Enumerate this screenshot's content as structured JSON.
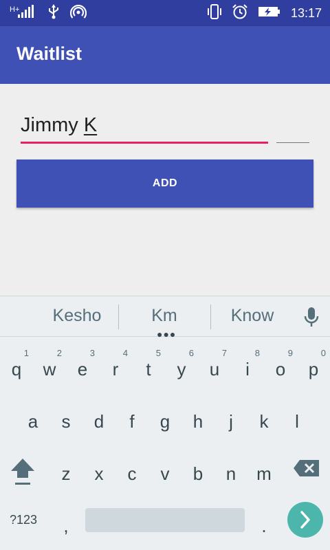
{
  "status_bar": {
    "network_label": "H+",
    "time": "13:17"
  },
  "app_bar": {
    "title": "Waitlist"
  },
  "form": {
    "name_value_first": "Jimmy ",
    "name_value_last": "K",
    "party_count_value": "",
    "add_button_label": "ADD"
  },
  "keyboard": {
    "suggestions": [
      "Kesho",
      "Km",
      "Know"
    ],
    "row1": [
      {
        "ch": "q",
        "num": "1"
      },
      {
        "ch": "w",
        "num": "2"
      },
      {
        "ch": "e",
        "num": "3"
      },
      {
        "ch": "r",
        "num": "4"
      },
      {
        "ch": "t",
        "num": "5"
      },
      {
        "ch": "y",
        "num": "6"
      },
      {
        "ch": "u",
        "num": "7"
      },
      {
        "ch": "i",
        "num": "8"
      },
      {
        "ch": "o",
        "num": "9"
      },
      {
        "ch": "p",
        "num": "0"
      }
    ],
    "row2": [
      "a",
      "s",
      "d",
      "f",
      "g",
      "h",
      "j",
      "k",
      "l"
    ],
    "row3": [
      "z",
      "x",
      "c",
      "v",
      "b",
      "n",
      "m"
    ],
    "symbols_label": "?123",
    "comma": ",",
    "period": "."
  },
  "colors": {
    "primary": "#3f51b5",
    "primary_dark": "#303f9f",
    "accent": "#e91e63",
    "go_key": "#4db6ac"
  }
}
